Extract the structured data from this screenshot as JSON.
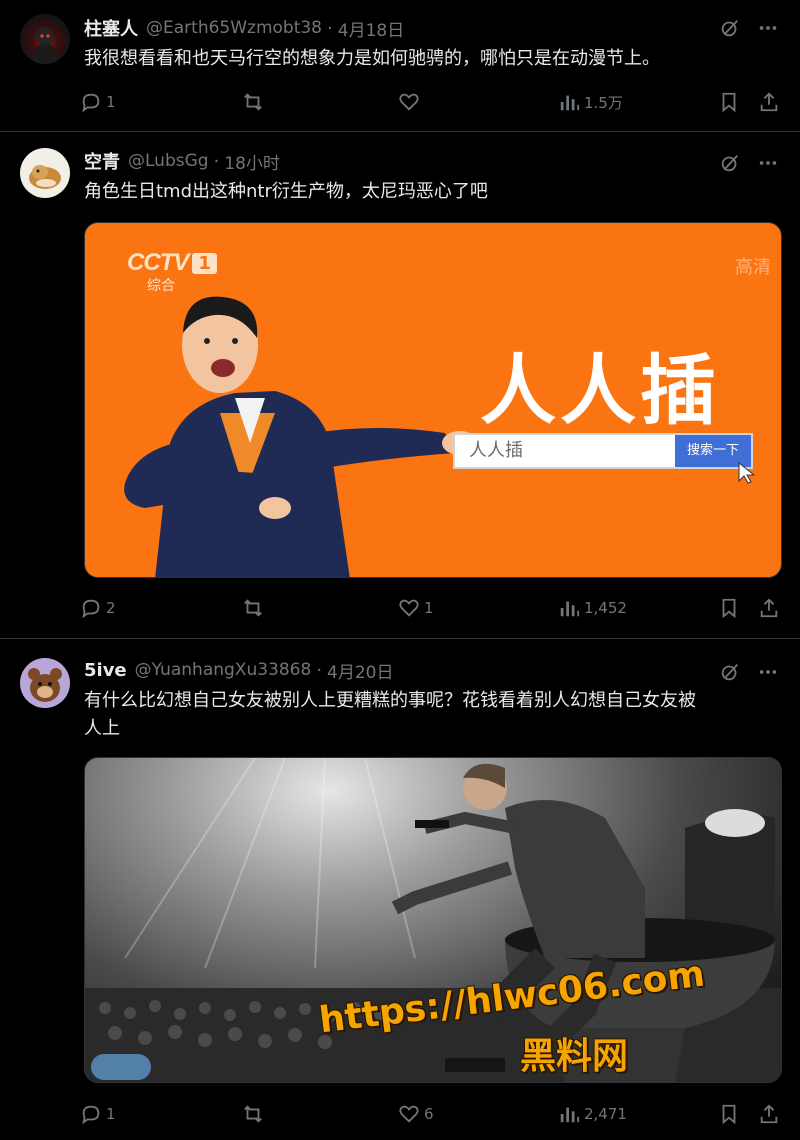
{
  "tweets": [
    {
      "name": "柱塞人",
      "handle": "@Earth65Wzmobt38",
      "time": "4月18日",
      "text": "我很想看看和也天马行空的想象力是如何驰骋的，哪怕只是在动漫节上。",
      "replies": "1",
      "likes": "",
      "views": "1.5万"
    },
    {
      "name": "空青",
      "handle": "@LubsGg",
      "time": "18小时",
      "text": "角色生日tmd出这种ntr衍生产物，太尼玛恶心了吧",
      "replies": "2",
      "likes": "1",
      "views": "1,452",
      "media": {
        "logo": "CCTV",
        "logo_num": "1",
        "channel": "综合",
        "hd": "高清",
        "headline": "人人插",
        "search_text": "人人插",
        "search_button": "搜索一下"
      }
    },
    {
      "name": "5ive",
      "handle": "@YuanhangXu33868",
      "time": "4月20日",
      "text_line1": "有什么比幻想自己女友被别人上更糟糕的事呢？花钱看着别人幻想自己女友被",
      "text_line2": "人上",
      "replies": "1",
      "likes": "6",
      "views": "2,471"
    }
  ],
  "watermark": {
    "url": "https://hlwc06.com",
    "site": "黑料网"
  },
  "colors": {
    "background": "#000000",
    "text": "#e7e9ea",
    "muted": "#71767b",
    "divider": "#2f3336",
    "media_orange": "#fb7412",
    "watermark": "#f6a400"
  }
}
